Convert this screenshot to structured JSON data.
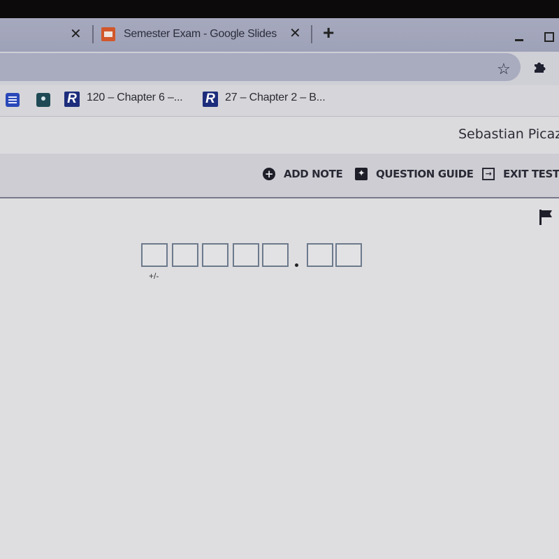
{
  "browser": {
    "tabs": [
      {
        "title": "",
        "close_icon": "✕"
      },
      {
        "title": "Semester Exam - Google Slides",
        "icon": "google-slides-icon",
        "close_icon": "✕",
        "active": true
      }
    ],
    "new_tab_icon": "+",
    "window_controls": {
      "minimize": "minimize-icon",
      "restore": "restore-icon"
    },
    "toolbar": {
      "star_icon": "☆",
      "extensions_icon": "puzzle-icon"
    },
    "bookmarks": [
      {
        "icon": "google-docs-icon",
        "label": ""
      },
      {
        "icon": "google-classroom-icon",
        "label": ""
      },
      {
        "icon": "R",
        "label": "120 – Chapter 6 –..."
      },
      {
        "icon": "R",
        "label": "27 – Chapter 2 – B..."
      }
    ]
  },
  "header": {
    "user_name": "Sebastian Picazo"
  },
  "actions": {
    "add_note": {
      "label": "ADD NOTE",
      "icon": "+"
    },
    "question_guide": {
      "label": "QUESTION GUIDE",
      "icon": "✦"
    },
    "exit_test": {
      "label": "EXIT TEST",
      "icon": "→"
    }
  },
  "question": {
    "flag_icon": "flag-icon",
    "answer_input": {
      "integer_digits": [
        "",
        "",
        "",
        "",
        ""
      ],
      "decimal_separator": ".",
      "decimal_digits": [
        "",
        ""
      ],
      "sign_label": "+/-"
    }
  }
}
